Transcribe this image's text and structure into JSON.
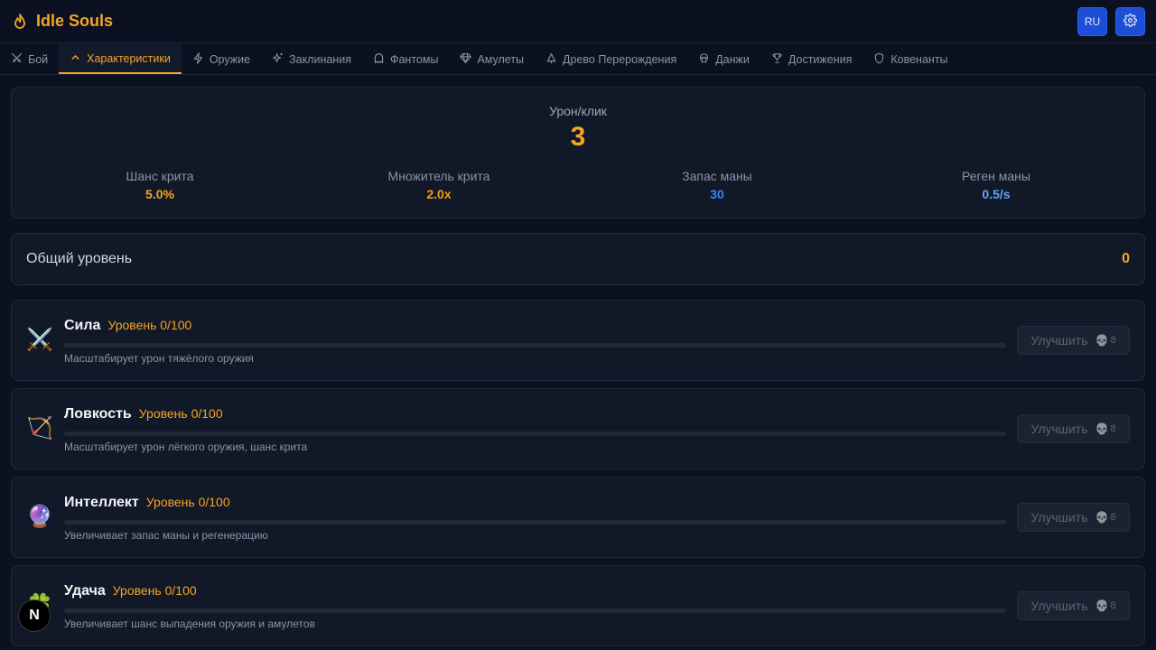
{
  "app": {
    "title": "Idle Souls"
  },
  "header": {
    "lang_label": "RU"
  },
  "tabs": [
    {
      "label": "Бой",
      "icon": "swords-icon",
      "active": false
    },
    {
      "label": "Характеристики",
      "icon": "chevron-up-icon",
      "active": true
    },
    {
      "label": "Оружие",
      "icon": "bolt-icon",
      "active": false
    },
    {
      "label": "Заклинания",
      "icon": "sparkles-icon",
      "active": false
    },
    {
      "label": "Фантомы",
      "icon": "ghost-icon",
      "active": false
    },
    {
      "label": "Амулеты",
      "icon": "gem-icon",
      "active": false
    },
    {
      "label": "Древо Перерождения",
      "icon": "tree-icon",
      "active": false
    },
    {
      "label": "Данжи",
      "icon": "skull-icon",
      "active": false
    },
    {
      "label": "Достижения",
      "icon": "trophy-icon",
      "active": false
    },
    {
      "label": "Ковенанты",
      "icon": "shield-icon",
      "active": false
    }
  ],
  "stats": {
    "damage_label": "Урон/клик",
    "damage_value": "3",
    "crit_chance_label": "Шанс крита",
    "crit_chance_value": "5.0%",
    "crit_mult_label": "Множитель крита",
    "crit_mult_value": "2.0x",
    "mana_pool_label": "Запас маны",
    "mana_pool_value": "30",
    "mana_regen_label": "Реген маны",
    "mana_regen_value": "0.5/s"
  },
  "overall_level": {
    "label": "Общий уровень",
    "value": "0"
  },
  "attributes": [
    {
      "icon": "⚔️",
      "name": "Сила",
      "level": "Уровень 0/100",
      "progress": 0,
      "desc": "Масштабирует урон тяжёлого оружия",
      "button": "Улучшить",
      "cost": "8"
    },
    {
      "icon": "🏹",
      "name": "Ловкость",
      "level": "Уровень 0/100",
      "progress": 0,
      "desc": "Масштабирует урон лёгкого оружия, шанс крита",
      "button": "Улучшить",
      "cost": "8"
    },
    {
      "icon": "🔮",
      "name": "Интеллект",
      "level": "Уровень 0/100",
      "progress": 0,
      "desc": "Увеличивает запас маны и регенерацию",
      "button": "Улучшить",
      "cost": "8"
    },
    {
      "icon": "🍀",
      "name": "Удача",
      "level": "Уровень 0/100",
      "progress": 0,
      "desc": "Увеличивает шанс выпадения оружия и амулетов",
      "button": "Улучшить",
      "cost": "8"
    }
  ],
  "badge": {
    "label": "N"
  },
  "colors": {
    "accent": "#f5a524",
    "crit_mult": "#f59e0b",
    "mana_pool": "#3b82f6",
    "mana_regen": "#60a5fa",
    "primary_button": "#1d4ed8"
  }
}
